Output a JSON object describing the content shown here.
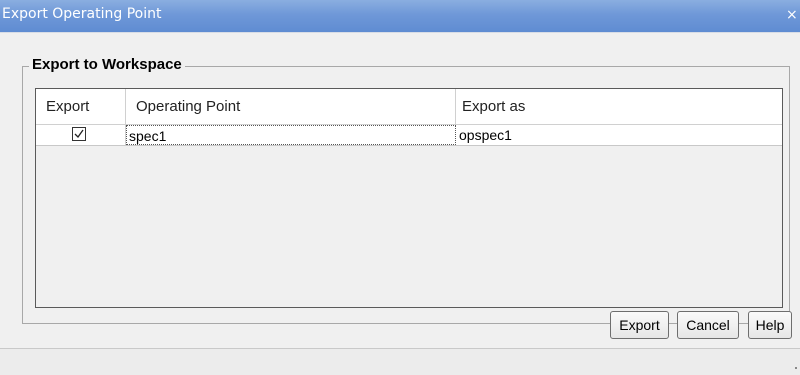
{
  "window": {
    "title": "Export Operating Point",
    "close_glyph": "×"
  },
  "group": {
    "legend": "Export to Workspace"
  },
  "table": {
    "columns": [
      "Export",
      "Operating Point",
      "Export as"
    ],
    "rows": [
      {
        "export": true,
        "operating_point": "spec1",
        "export_as": "opspec1"
      }
    ]
  },
  "buttons": {
    "export": "Export",
    "cancel": "Cancel",
    "help": "Help"
  },
  "colors": {
    "titlebar": "#6f98d8",
    "background": "#f0f0f0"
  },
  "icons": {
    "checkbox": "checkmark-icon",
    "close": "close-icon",
    "resize": "resize-grip-icon"
  }
}
